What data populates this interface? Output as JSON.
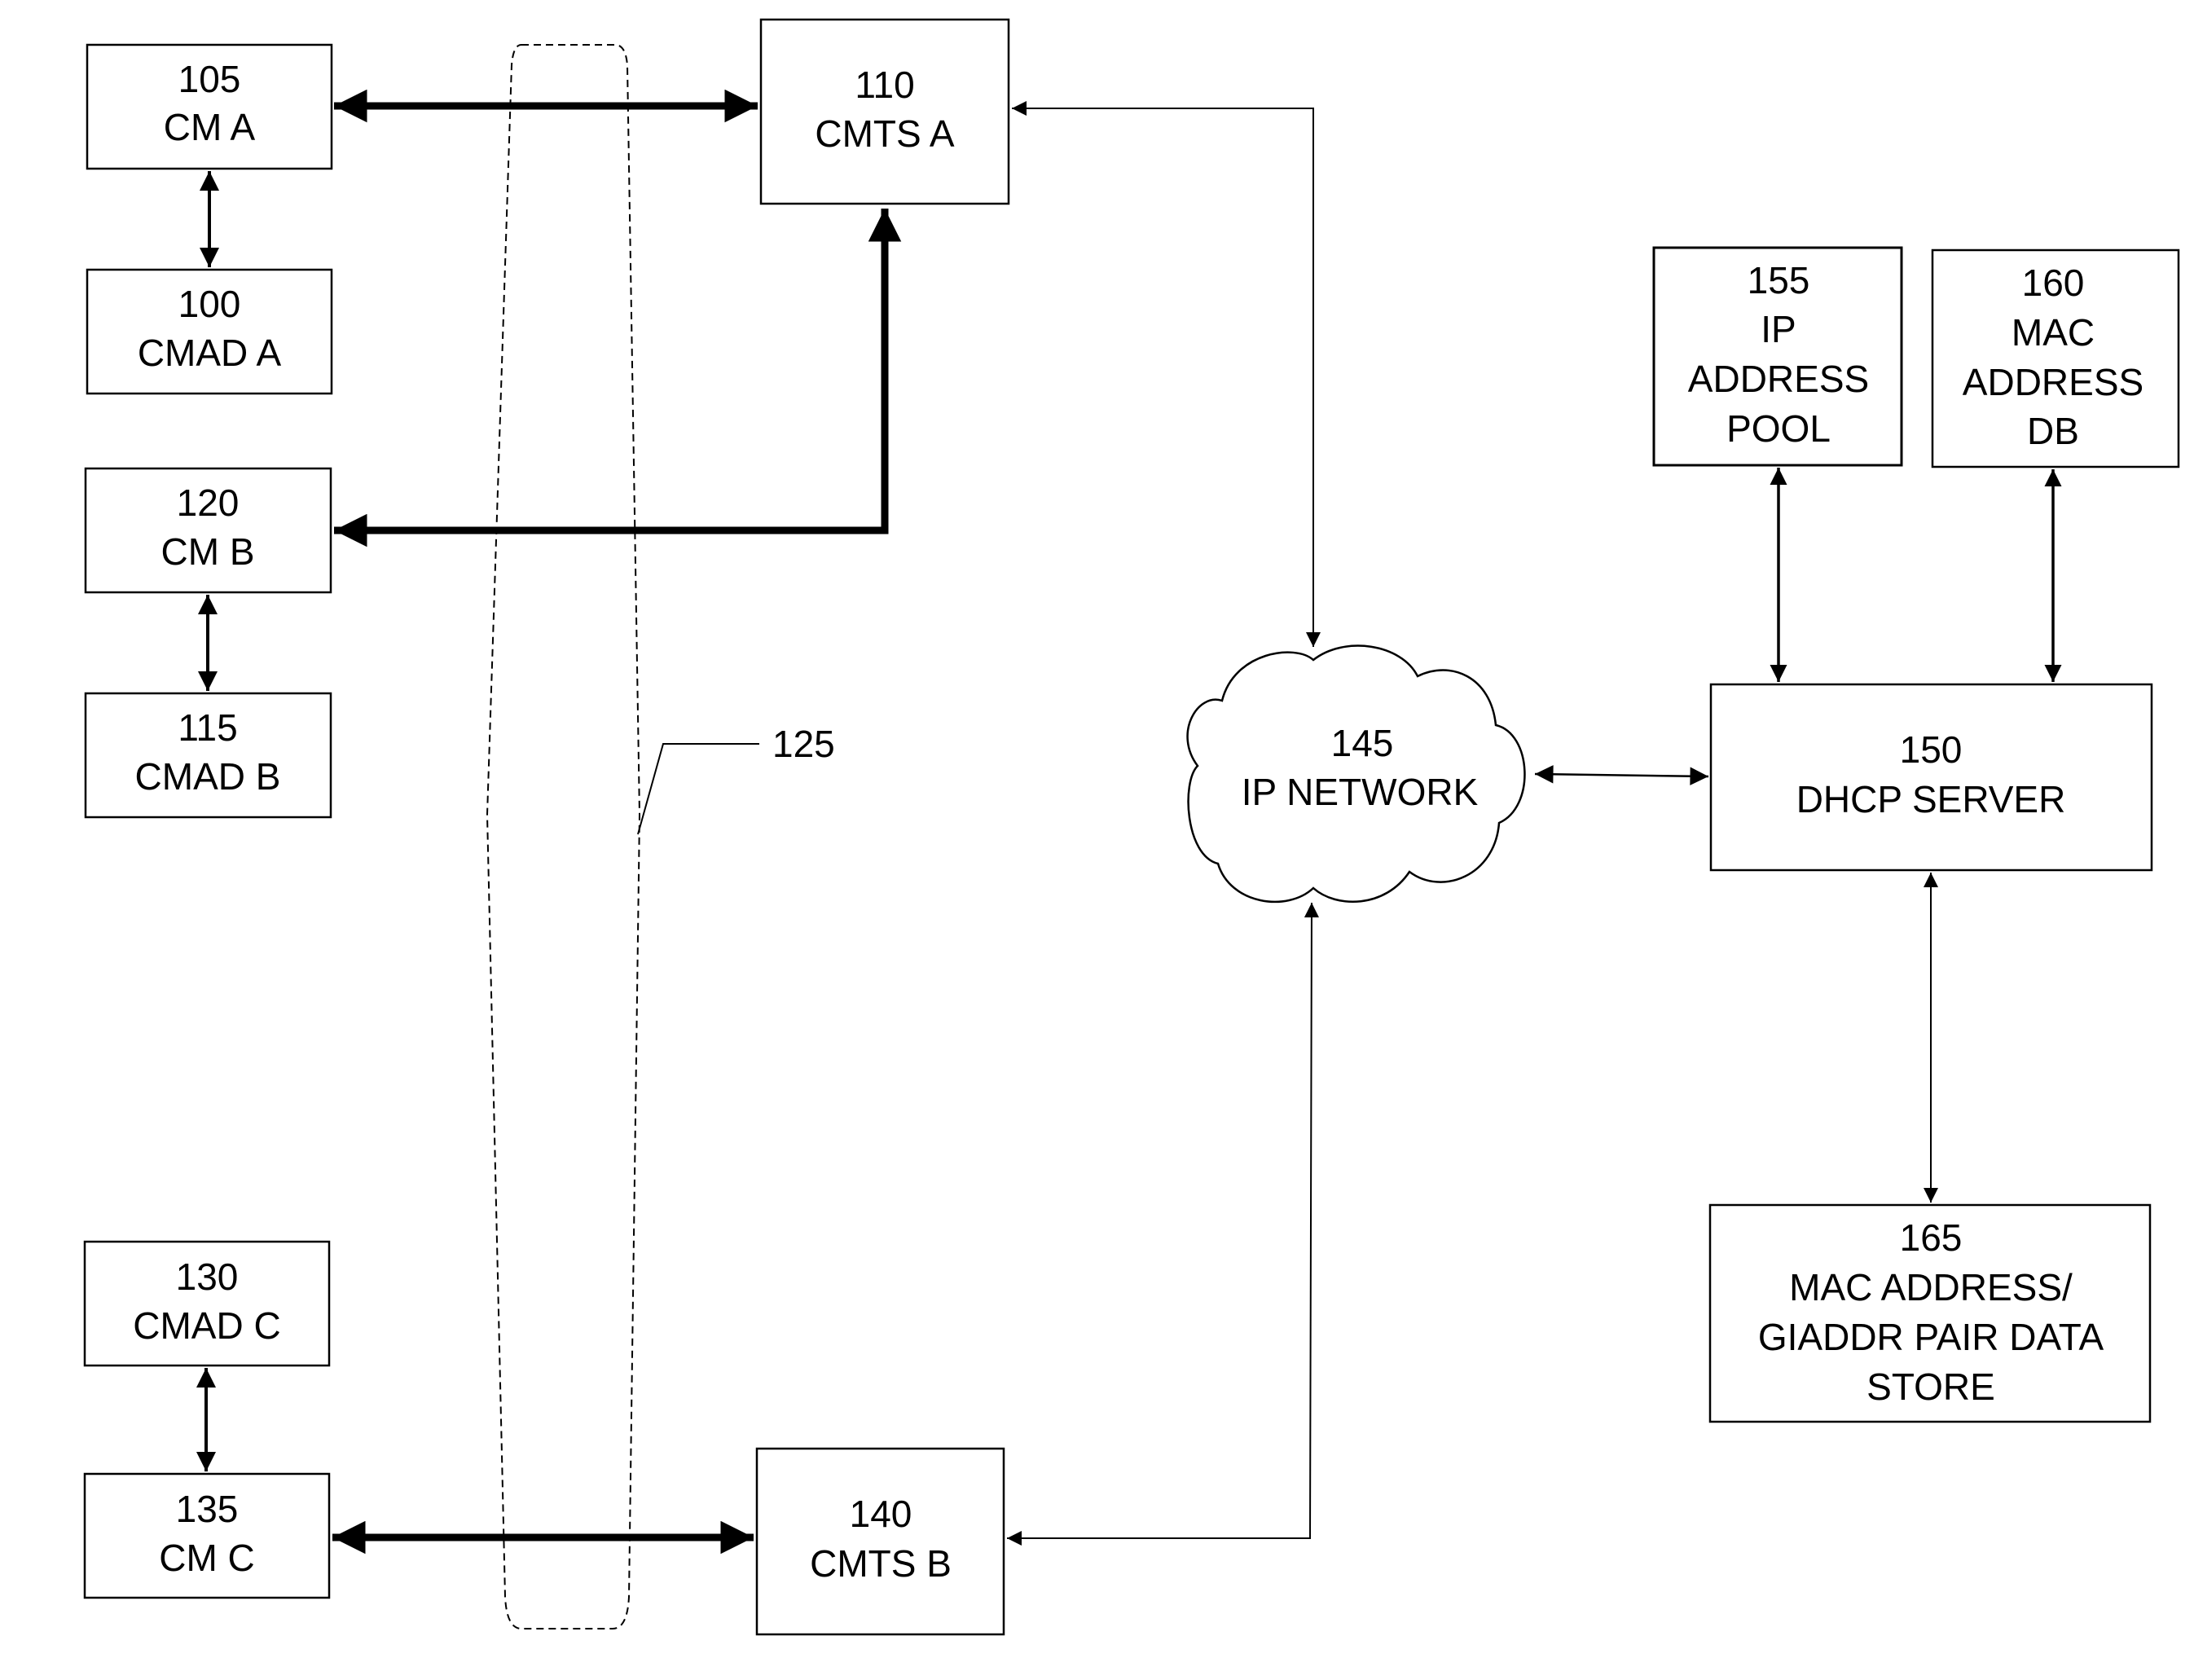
{
  "diagram": {
    "title": "",
    "nodes": {
      "cm_a": {
        "lines": [
          "105",
          "CM A"
        ]
      },
      "cmad_a": {
        "lines": [
          "100",
          "CMAD A"
        ]
      },
      "cm_b": {
        "lines": [
          "120",
          "CM B"
        ]
      },
      "cmad_b": {
        "lines": [
          "115",
          "CMAD B"
        ]
      },
      "cmts_a": {
        "lines": [
          "110",
          "CMTS A"
        ]
      },
      "cmad_c": {
        "lines": [
          "130",
          "CMAD C"
        ]
      },
      "cm_c": {
        "lines": [
          "135",
          "CM C"
        ]
      },
      "cmts_b": {
        "lines": [
          "140",
          "CMTS B"
        ]
      },
      "ip_network": {
        "lines": [
          "145",
          "IP NETWORK"
        ]
      },
      "dhcp": {
        "lines": [
          "150",
          "DHCP SERVER"
        ]
      },
      "ip_pool": {
        "lines": [
          "155",
          "IP",
          "ADDRESS",
          "POOL"
        ]
      },
      "mac_db": {
        "lines": [
          "160",
          "MAC",
          "ADDRESS",
          "DB"
        ]
      },
      "pair_store": {
        "lines": [
          "165",
          "MAC ADDRESS/",
          "GIADDR PAIR DATA",
          "STORE"
        ]
      }
    },
    "ref_labels": {
      "hfc_network": "125"
    },
    "connections": [
      {
        "from": "cm_a",
        "to": "cmts_a",
        "style": "thick",
        "direction": "both"
      },
      {
        "from": "cm_a",
        "to": "cmad_a",
        "style": "medium",
        "direction": "both"
      },
      {
        "from": "cm_b",
        "to": "cmts_a",
        "style": "thick",
        "direction": "both"
      },
      {
        "from": "cm_b",
        "to": "cmad_b",
        "style": "medium",
        "direction": "both"
      },
      {
        "from": "cmad_c",
        "to": "cm_c",
        "style": "medium",
        "direction": "both"
      },
      {
        "from": "cm_c",
        "to": "cmts_b",
        "style": "thick",
        "direction": "both"
      },
      {
        "from": "cmts_a",
        "to": "ip_network",
        "style": "thin",
        "direction": "both"
      },
      {
        "from": "cmts_b",
        "to": "ip_network",
        "style": "thin",
        "direction": "both"
      },
      {
        "from": "ip_network",
        "to": "dhcp",
        "style": "thin",
        "direction": "both"
      },
      {
        "from": "dhcp",
        "to": "ip_pool",
        "style": "medium",
        "direction": "both"
      },
      {
        "from": "dhcp",
        "to": "mac_db",
        "style": "medium",
        "direction": "both"
      },
      {
        "from": "dhcp",
        "to": "pair_store",
        "style": "thin",
        "direction": "both"
      }
    ]
  }
}
